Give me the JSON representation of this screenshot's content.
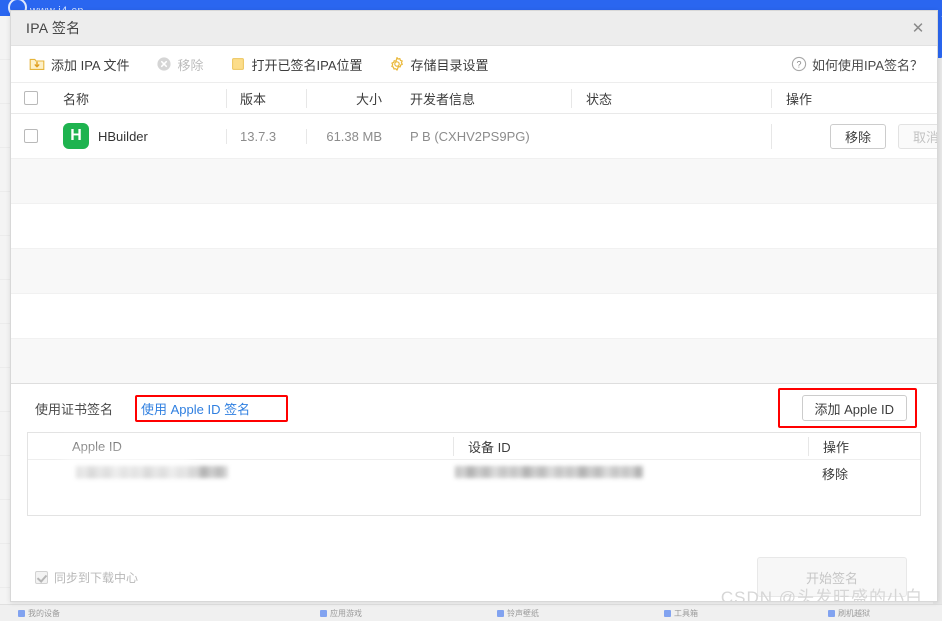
{
  "background": {
    "site_logo_text": "www.i4.cn",
    "bottom_toolbar_items": [
      {
        "label": "我的设备"
      },
      {
        "label": "应用游戏"
      },
      {
        "label": "铃声壁纸"
      },
      {
        "label": "工具箱"
      },
      {
        "label": "刷机越狱"
      }
    ],
    "left_strip_marks": [
      "日",
      "I",
      "",
      "",
      "",
      "",
      "",
      "",
      "",
      "I",
      "",
      "",
      "|"
    ]
  },
  "dialog": {
    "title": "IPA 签名",
    "close_icon": "close-icon"
  },
  "toolbar": {
    "items": [
      {
        "label": "添加 IPA 文件",
        "icon": "folder-download-icon",
        "disabled": false
      },
      {
        "label": "移除",
        "icon": "circle-x-icon",
        "disabled": true
      },
      {
        "label": "打开已签名IPA位置",
        "icon": "folder-icon",
        "disabled": false
      },
      {
        "label": "存储目录设置",
        "icon": "gear-icon",
        "disabled": false
      }
    ],
    "help": {
      "label": "如何使用IPA签名？",
      "icon": "question-circle-icon"
    }
  },
  "main_table": {
    "columns": [
      "名称",
      "版本",
      "大小",
      "开发者信息",
      "状态",
      "操作"
    ],
    "select_all_checked": false,
    "rows": [
      {
        "checked": false,
        "icon_letter": "H",
        "icon_color": "#1eb34f",
        "name": "HBuilder",
        "version": "13.7.3",
        "size": "61.38 MB",
        "developer": "P B (CXHV2PS9PG)",
        "status": "",
        "actions": [
          {
            "label": "移除",
            "disabled": false
          },
          {
            "label": "取消",
            "disabled": true
          }
        ]
      }
    ],
    "empty_row_count": 6
  },
  "bottom_panel": {
    "tabs": [
      {
        "label": "使用证书签名",
        "active": false
      },
      {
        "label": "使用 Apple ID 签名",
        "active": true
      }
    ],
    "add_apple_id_button": "添加 Apple ID",
    "id_table": {
      "columns": [
        "Apple ID",
        "设备 ID",
        "操作"
      ],
      "rows": [
        {
          "apple_id": "",
          "device_id": "",
          "action": "移除",
          "redacted": true
        }
      ]
    }
  },
  "footer": {
    "sync_label": "同步到下载中心",
    "sync_checked": true,
    "start_sign_button": "开始签名",
    "start_sign_disabled": true
  },
  "watermark": "CSDN @头发旺盛的小白",
  "colors": {
    "accent_blue": "#2a66f0",
    "tab_active": "#2f7fe0",
    "annotation_red": "#ff0000",
    "app_icon_green": "#1eb34f",
    "icon_yellow": "#f5c243"
  }
}
